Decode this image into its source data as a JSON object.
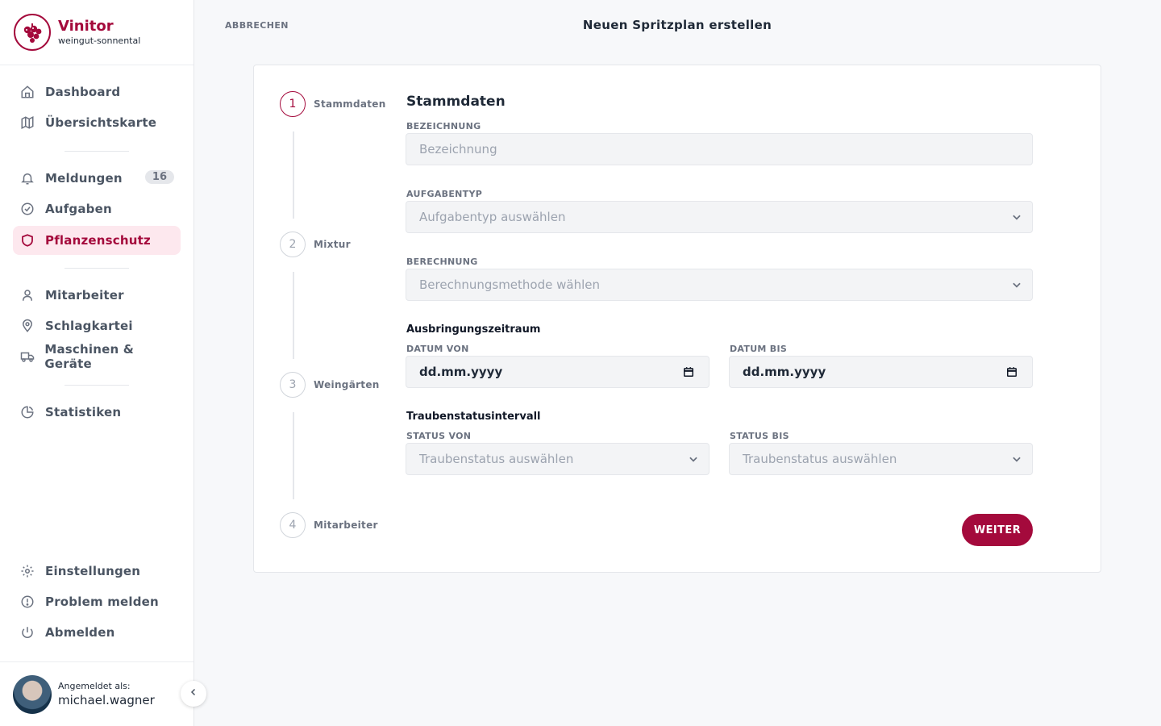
{
  "brand": {
    "name": "Vinitor",
    "subtitle": "weingut-sonnental"
  },
  "nav": {
    "dashboard": "Dashboard",
    "overview_map": "Übersichtskarte",
    "notifications": "Meldungen",
    "notifications_count": "16",
    "tasks": "Aufgaben",
    "plant_protection": "Pflanzenschutz",
    "employees": "Mitarbeiter",
    "field_records": "Schlagkartei",
    "machines": "Maschinen & Geräte",
    "statistics": "Statistiken",
    "settings": "Einstellungen",
    "report_problem": "Problem melden",
    "logout": "Abmelden"
  },
  "user": {
    "label": "Angemeldet als:",
    "name": "michael.wagner"
  },
  "header": {
    "cancel": "ABBRECHEN",
    "title": "Neuen Spritzplan erstellen"
  },
  "steps": [
    {
      "number": "1",
      "label": "Stammdaten",
      "active": true
    },
    {
      "number": "2",
      "label": "Mixtur",
      "active": false
    },
    {
      "number": "3",
      "label": "Weingärten",
      "active": false
    },
    {
      "number": "4",
      "label": "Mitarbeiter",
      "active": false
    }
  ],
  "form": {
    "section_title": "Stammdaten",
    "name_label": "BEZEICHNUNG",
    "name_placeholder": "Bezeichnung",
    "task_type_label": "AUFGABENTYP",
    "task_type_placeholder": "Aufgabentyp auswählen",
    "calculation_label": "BERECHNUNG",
    "calculation_placeholder": "Berechnungsmethode wählen",
    "period_title": "Ausbringungszeitraum",
    "date_from_label": "DATUM VON",
    "date_from_value": "dd.mm.yyyy",
    "date_to_label": "DATUM BIS",
    "date_to_value": "dd.mm.yyyy",
    "grape_interval_title": "Traubenstatusintervall",
    "status_from_label": "STATUS VON",
    "status_from_placeholder": "Traubenstatus auswählen",
    "status_to_label": "STATUS BIS",
    "status_to_placeholder": "Traubenstatus auswählen",
    "next_button": "WEITER"
  },
  "colors": {
    "accent": "#a40a3c",
    "accent_soft": "#fde8ee"
  },
  "icons": [
    "home-icon",
    "map-icon",
    "bell-icon",
    "check-circle-icon",
    "shield-icon",
    "user-icon",
    "map-pin-icon",
    "truck-icon",
    "pie-chart-icon",
    "gear-icon",
    "alert-circle-icon",
    "power-icon",
    "chevron-left-icon",
    "chevron-down-icon",
    "calendar-icon",
    "grapes-logo-icon"
  ]
}
